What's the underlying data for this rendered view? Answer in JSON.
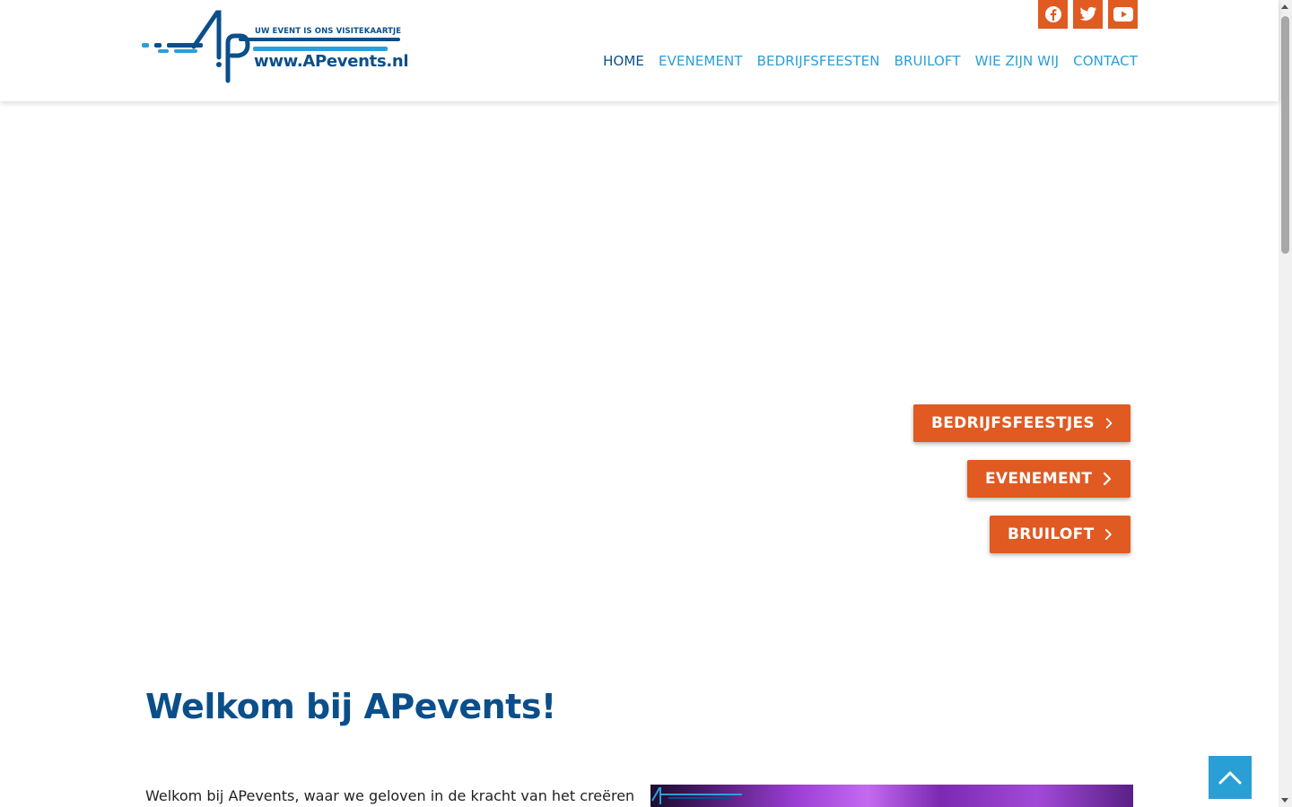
{
  "header": {
    "logo": {
      "tagline": "UW EVENT IS ONS VISITEKAARTJE",
      "url": "www.APevents.nl",
      "brand_dark": "#0b4f8a",
      "brand_light": "#2a9fd6"
    },
    "social": [
      {
        "icon": "facebook-icon"
      },
      {
        "icon": "twitter-icon"
      },
      {
        "icon": "youtube-icon"
      }
    ],
    "nav": [
      {
        "label": "HOME",
        "active": true
      },
      {
        "label": "EVENEMENT",
        "active": false
      },
      {
        "label": "BEDRIJFSFEESTEN",
        "active": false
      },
      {
        "label": "BRUILOFT",
        "active": false
      },
      {
        "label": "WIE ZIJN WIJ",
        "active": false
      },
      {
        "label": "CONTACT",
        "active": false
      }
    ]
  },
  "hero": {
    "buttons": [
      {
        "label": "BEDRIJFSFEESTJES"
      },
      {
        "label": "EVENEMENT"
      },
      {
        "label": "BRUILOFT"
      }
    ],
    "accent": "#e05a22"
  },
  "welcome": {
    "title": "Welkom bij APevents!",
    "text": "Welkom bij APevents, waar we geloven in de kracht van het creëren"
  },
  "scroll_top": {
    "icon": "chevron-up-icon"
  }
}
